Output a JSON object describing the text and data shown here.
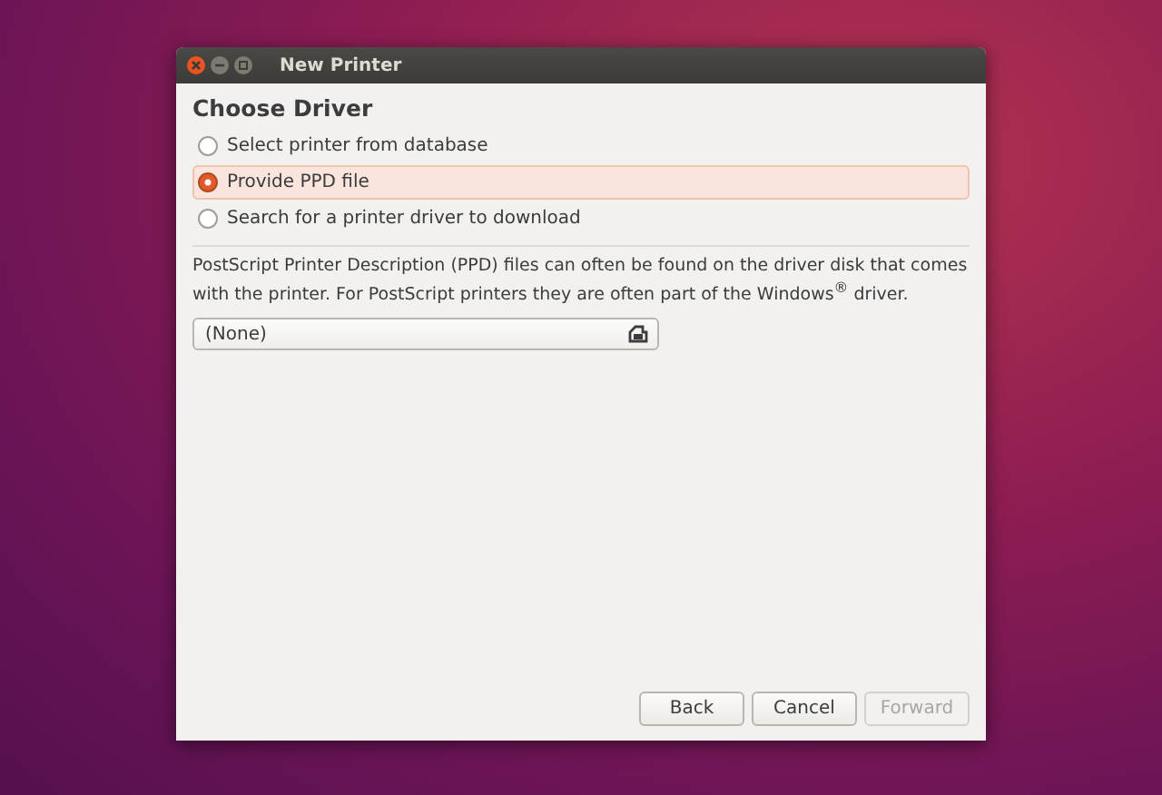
{
  "window": {
    "title": "New Printer"
  },
  "heading": "Choose Driver",
  "options": [
    {
      "label": "Select printer from database",
      "selected": false
    },
    {
      "label": "Provide PPD file",
      "selected": true
    },
    {
      "label": "Search for a printer driver to download",
      "selected": false
    }
  ],
  "description": "PostScript Printer Description (PPD) files can often be found on the driver disk that comes with the printer. For PostScript printers they are often part of the Windows$^{®}$ driver.",
  "file_chooser": {
    "value": "(None)"
  },
  "buttons": [
    {
      "label": "Back",
      "disabled": false
    },
    {
      "label": "Cancel",
      "disabled": false
    },
    {
      "label": "Forward",
      "disabled": true
    }
  ]
}
